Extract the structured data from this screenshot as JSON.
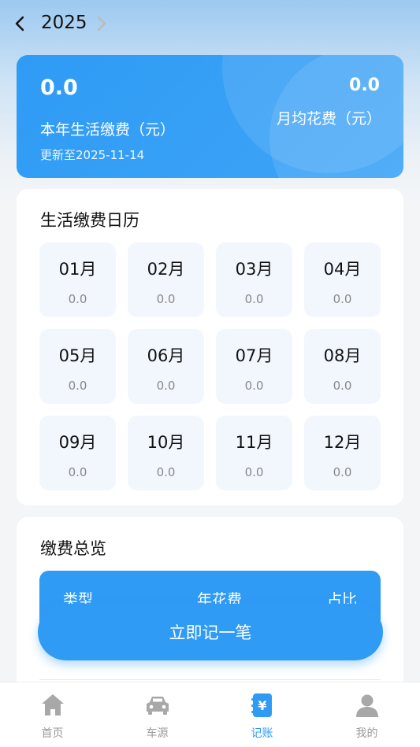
{
  "header": {
    "year": "2025"
  },
  "summary": {
    "total_value": "0.0",
    "total_label": "本年生活缴费（元）",
    "updated": "更新至2025-11-14",
    "avg_value": "0.0",
    "avg_label": "月均花费（元）"
  },
  "calendar": {
    "title": "生活缴费日历",
    "months": [
      {
        "label": "01月",
        "value": "0.0"
      },
      {
        "label": "02月",
        "value": "0.0"
      },
      {
        "label": "03月",
        "value": "0.0"
      },
      {
        "label": "04月",
        "value": "0.0"
      },
      {
        "label": "05月",
        "value": "0.0"
      },
      {
        "label": "06月",
        "value": "0.0"
      },
      {
        "label": "07月",
        "value": "0.0"
      },
      {
        "label": "08月",
        "value": "0.0"
      },
      {
        "label": "09月",
        "value": "0.0"
      },
      {
        "label": "10月",
        "value": "0.0"
      },
      {
        "label": "11月",
        "value": "0.0"
      },
      {
        "label": "12月",
        "value": "0.0"
      }
    ]
  },
  "overview": {
    "title": "缴费总览",
    "columns": [
      "类型",
      "年花费",
      "占比"
    ]
  },
  "record_button": {
    "label": "立即记一笔"
  },
  "nav": {
    "items": [
      {
        "label": "首页",
        "icon": "home-icon",
        "active": false
      },
      {
        "label": "车源",
        "icon": "car-icon",
        "active": false
      },
      {
        "label": "记账",
        "icon": "ledger-icon",
        "active": true
      },
      {
        "label": "我的",
        "icon": "profile-icon",
        "active": false
      }
    ]
  },
  "colors": {
    "accent": "#2f9bf5",
    "inactive": "#999999",
    "cell_bg": "#f2f7fd"
  }
}
